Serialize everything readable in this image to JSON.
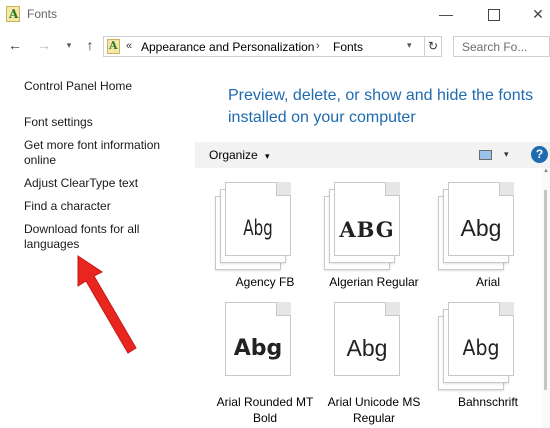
{
  "window": {
    "title": "Fonts",
    "controls": {
      "minimize": "—",
      "maximize": "",
      "close": "✕"
    }
  },
  "nav": {
    "back": "←",
    "forward": "→",
    "recent": "▾",
    "up": "↑",
    "address": {
      "chevron": "«",
      "segments": [
        "Appearance and Personalization",
        "Fonts"
      ],
      "separator": "›",
      "dropdown": "▾"
    },
    "refresh": "↻",
    "search_placeholder": "Search Fo..."
  },
  "sidebar": {
    "items": [
      "Control Panel Home",
      "Font settings",
      "Get more font information online",
      "Adjust ClearType text",
      "Find a character",
      "Download fonts for all languages"
    ]
  },
  "main": {
    "heading": "Preview, delete, or show and hide the fonts installed on your computer",
    "toolbar": {
      "organize": "Organize",
      "organize_caret": "▾",
      "view_caret": "▾",
      "help": "?"
    },
    "fonts": [
      {
        "name": "Agency FB",
        "sample": "Abg"
      },
      {
        "name": "Algerian Regular",
        "sample": "ABG"
      },
      {
        "name": "Arial",
        "sample": "Abg"
      },
      {
        "name": "Arial Rounded MT Bold",
        "sample": "Abg"
      },
      {
        "name": "Arial Unicode MS Regular",
        "sample": "Abg"
      },
      {
        "name": "Bahnschrift",
        "sample": "Abg"
      }
    ]
  },
  "colors": {
    "heading": "#1e6bb0",
    "annotation_arrow": "#e8251f",
    "toolbar_bg": "#f2f2f2"
  }
}
